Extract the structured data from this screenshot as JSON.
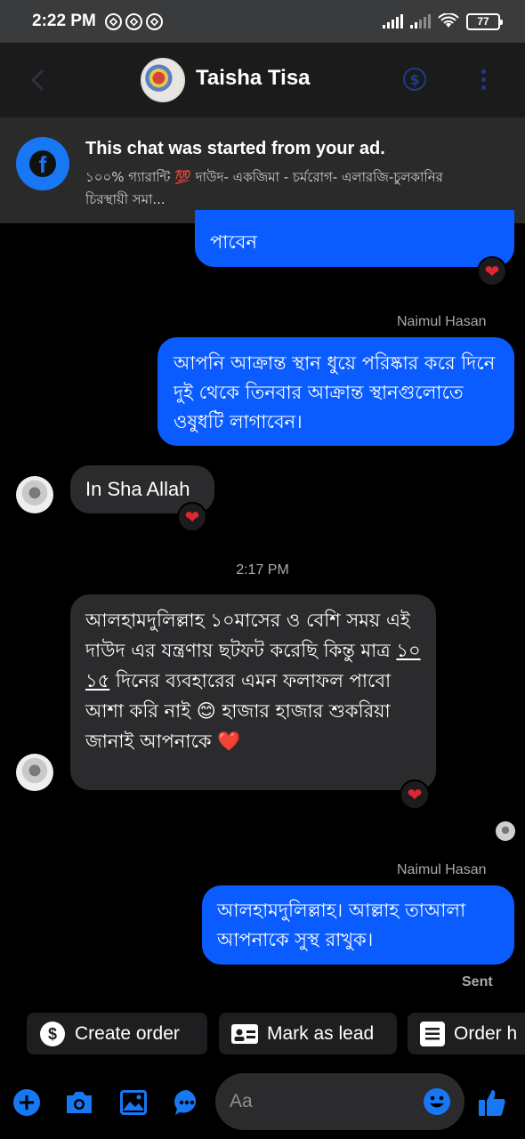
{
  "status_bar": {
    "time": "2:22 PM",
    "battery": "77",
    "icons": [
      "sync-icon",
      "sync-icon",
      "sync-icon",
      "signal-icon",
      "signal-icon",
      "wifi-icon",
      "battery-icon"
    ]
  },
  "header": {
    "name": "Taisha Tisa",
    "icons": [
      "back-icon",
      "dollar-icon",
      "more-icon"
    ]
  },
  "ad_banner": {
    "title": "This chat was started from your ad.",
    "subtitle": "১০০% গ্যারান্টি 💯 দাউদ- একজিমা - চর্মরোগ-  এলারজি-চুলকানির চিরস্থায়ী সমা..."
  },
  "messages": [
    {
      "type": "outgoing",
      "text": "পাবেন",
      "reaction": "❤"
    },
    {
      "type": "outgoing",
      "sender": "Naimul Hasan",
      "text": "আপনি আক্রান্ত স্থান ধুয়ে পরিষ্কার করে দিনে দুই থেকে তিনবার আক্রান্ত স্থানগুলোতে ওষুধটি লাগাবেন।"
    },
    {
      "type": "incoming",
      "text": "In Sha Allah",
      "reaction": "❤"
    },
    {
      "type": "timestamp",
      "text": "2:17 PM"
    },
    {
      "type": "incoming",
      "text_before_link": "আলহামদুলিল্লাহ ১০মাসের ও বেশি সময় এই দাউদ এর যন্ত্রণায় ছটফট করেছি কিন্তু মাত্র ",
      "link": "১০ ১৫",
      "text_after_link": " দিনের ব্যবহারের এমন ফলাফল পাবো আশা করি নাই 😊 হাজার হাজার শুকরিয়া জানাই আপনাকে ❤️",
      "reaction": "❤"
    },
    {
      "type": "outgoing",
      "sender": "Naimul Hasan",
      "text": "আলহামদুলিল্লাহ। আল্লাহ তাআলা আপনাকে সুস্থ রাখুক।",
      "status": "Sent"
    }
  ],
  "chips": [
    {
      "label": "Create order",
      "icon": "dollar-circle-icon"
    },
    {
      "label": "Mark as lead",
      "icon": "id-card-icon"
    },
    {
      "label": "Order h",
      "icon": "list-icon"
    }
  ],
  "composer": {
    "placeholder": "Aa",
    "icons": [
      "plus-icon",
      "camera-icon",
      "image-icon",
      "chat-icon",
      "emoji-icon",
      "like-icon"
    ]
  },
  "colors": {
    "accent": "#0a5cff",
    "header_bg": "#1b1b1b",
    "incoming_bubble": "#2b2b2e",
    "reaction": "#e22630",
    "icon_blue": "#1877f2"
  }
}
